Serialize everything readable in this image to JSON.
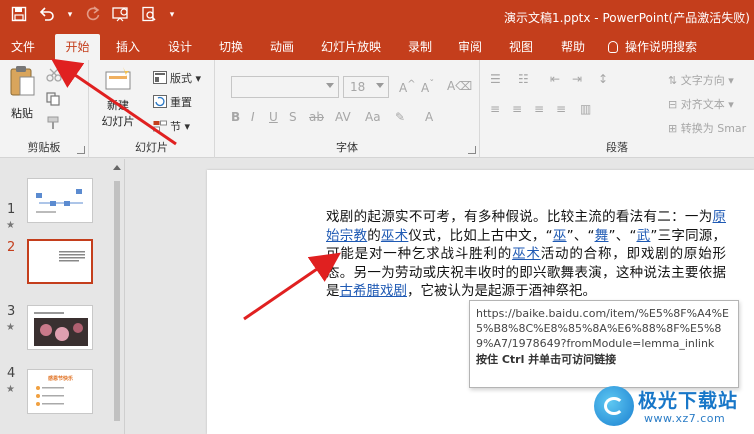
{
  "window": {
    "title": "演示文稿1.pptx  -  PowerPoint(产品激活失败)"
  },
  "qat": {
    "more": "▾"
  },
  "tabs": [
    {
      "label": "文件"
    },
    {
      "label": "开始"
    },
    {
      "label": "插入"
    },
    {
      "label": "设计"
    },
    {
      "label": "切换"
    },
    {
      "label": "动画"
    },
    {
      "label": "幻灯片放映"
    },
    {
      "label": "录制"
    },
    {
      "label": "审阅"
    },
    {
      "label": "视图"
    },
    {
      "label": "帮助"
    },
    {
      "label": "操作说明搜索"
    }
  ],
  "ribbon": {
    "clipboard": {
      "paste": "粘贴",
      "label": "剪贴板"
    },
    "slides": {
      "new_slide": "新建",
      "new_slide_2": "幻灯片",
      "layout": "版式",
      "reset": "重置",
      "section": "节",
      "label": "幻灯片"
    },
    "font": {
      "size": "18",
      "label": "字体"
    },
    "paragraph": {
      "text_direction": "文字方向",
      "align_text": "对齐文本",
      "convert_smartart": "转换为 Smar",
      "label": "段落"
    }
  },
  "slides_panel": {
    "slides": [
      {
        "number": "1",
        "star": "★"
      },
      {
        "number": "2",
        "star": ""
      },
      {
        "number": "3",
        "star": "★"
      },
      {
        "number": "4",
        "star": "★"
      }
    ],
    "slide4_title": "感恩节快乐"
  },
  "slide": {
    "body": [
      {
        "t": "戏剧的起源实不可考，有多种假说。比较主流的看法有二：一为",
        "link": false
      },
      {
        "t": "原始宗教",
        "link": true
      },
      {
        "t": "的",
        "link": false
      },
      {
        "t": "巫术",
        "link": true
      },
      {
        "t": "仪式，比如上古中文，“",
        "link": false
      },
      {
        "t": "巫",
        "link": true
      },
      {
        "t": "”、“",
        "link": false
      },
      {
        "t": "舞",
        "link": true
      },
      {
        "t": "”、“",
        "link": false
      },
      {
        "t": "武",
        "link": true
      },
      {
        "t": "”三字同源，可能是对一种乞求战斗胜利的",
        "link": false
      },
      {
        "t": "巫术",
        "link": true
      },
      {
        "t": "活动的合称，即戏剧的原始形态。另一为劳动或庆祝丰收时的即兴歌舞表演，这种说法主要依据是",
        "link": false
      },
      {
        "t": "古希腊戏剧",
        "link": true
      },
      {
        "t": "，它被认为是起源于酒神祭祀。",
        "link": false
      }
    ]
  },
  "tooltip": {
    "url": "https://baike.baidu.com/item/%E5%8F%A4%E5%B8%8C%E8%85%8A%E6%88%8F%E5%89%A7/1978649?fromModule=lemma_inlink",
    "hint": "按住 Ctrl 并单击可访问链接"
  },
  "watermark": {
    "title": "极光下载站",
    "url": "www.xz7.com"
  }
}
